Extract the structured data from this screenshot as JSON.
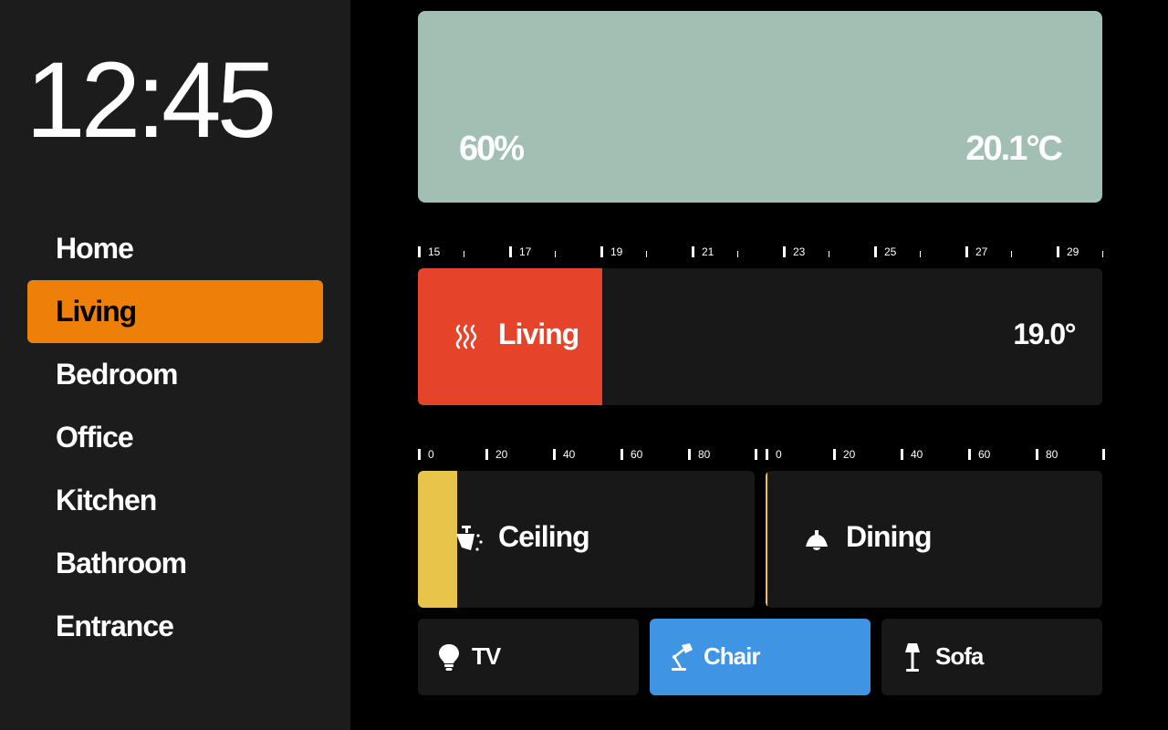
{
  "clock": "12:45",
  "nav": [
    {
      "label": "Home",
      "active": false
    },
    {
      "label": "Living",
      "active": true
    },
    {
      "label": "Bedroom",
      "active": false
    },
    {
      "label": "Office",
      "active": false
    },
    {
      "label": "Kitchen",
      "active": false
    },
    {
      "label": "Bathroom",
      "active": false
    },
    {
      "label": "Entrance",
      "active": false
    }
  ],
  "weather": {
    "humidity": "60%",
    "temperature": "20.1°C",
    "color": "#a2bfb4"
  },
  "thermostat": {
    "name": "Living",
    "icon": "heating-icon",
    "value": "19.0°",
    "setpoint": 19.0,
    "range": [
      15,
      30
    ],
    "color": "#e5432a",
    "scale_labels": [
      "15",
      "17",
      "19",
      "21",
      "23",
      "25",
      "27",
      "29"
    ]
  },
  "dimmers": [
    {
      "name": "Ceiling",
      "icon": "ceiling-spotlight-icon",
      "level_percent": 11.5,
      "color": "#e8c44a",
      "scale_labels": [
        "0",
        "20",
        "40",
        "60",
        "80"
      ]
    },
    {
      "name": "Dining",
      "icon": "pendant-lamp-icon",
      "level_percent": 0.5,
      "color": "#e8c44a",
      "scale_labels": [
        "0",
        "20",
        "40",
        "60",
        "80"
      ]
    }
  ],
  "switches": [
    {
      "name": "TV",
      "icon": "bulb-icon",
      "on": false
    },
    {
      "name": "Chair",
      "icon": "desk-lamp-icon",
      "on": true,
      "color": "#3f95e3"
    },
    {
      "name": "Sofa",
      "icon": "floor-lamp-icon",
      "on": false
    }
  ],
  "colors": {
    "accent": "#ee800a",
    "sidebar": "#1c1c1c",
    "card": "#181818"
  }
}
